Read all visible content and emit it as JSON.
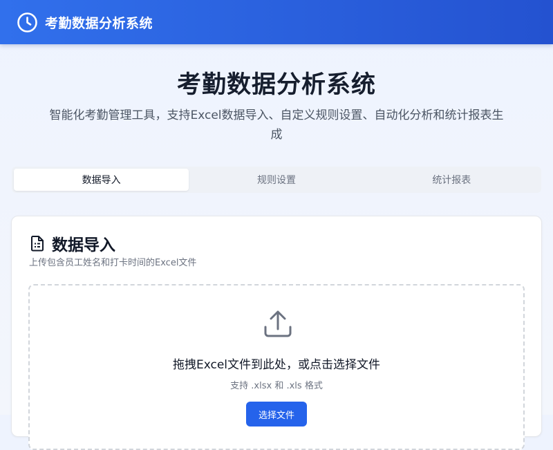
{
  "header": {
    "icon": "clock-icon",
    "title": "考勤数据分析系统"
  },
  "hero": {
    "title": "考勤数据分析系统",
    "subtitle": "智能化考勤管理工具，支持Excel数据导入、自定义规则设置、自动化分析和统计报表生成"
  },
  "tabs": [
    {
      "label": "数据导入",
      "active": true
    },
    {
      "label": "规则设置",
      "active": false
    },
    {
      "label": "统计报表",
      "active": false
    }
  ],
  "card": {
    "icon": "document-icon",
    "title": "数据导入",
    "description": "上传包含员工姓名和打卡时间的Excel文件"
  },
  "dropzone": {
    "icon": "upload-icon",
    "main_text": "拖拽Excel文件到此处，或点击选择文件",
    "hint": "支持 .xlsx 和 .xls 格式",
    "button_label": "选择文件"
  },
  "colors": {
    "header_gradient_start": "#3170ec",
    "header_gradient_end": "#2452d0",
    "primary_button": "#2563eb",
    "page_background": "#eef3fe"
  }
}
